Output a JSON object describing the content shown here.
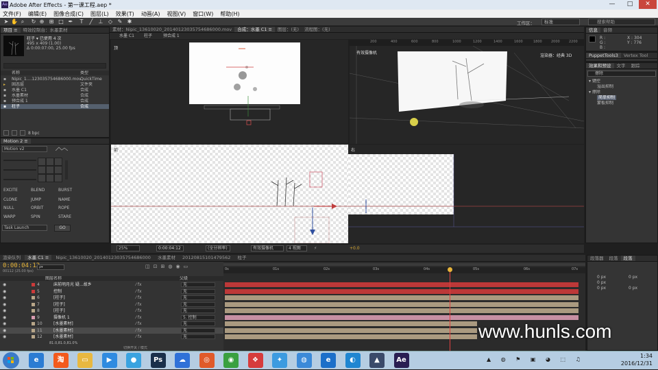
{
  "window": {
    "title": "Adobe After Effects - 第一课工程.aep *",
    "logo_text": "Ae",
    "minimize": "—",
    "maximize": "□",
    "close": "✕"
  },
  "menu": [
    "文件(F)",
    "编辑(E)",
    "图像合成(C)",
    "图层(L)",
    "效果(T)",
    "动画(A)",
    "视图(V)",
    "窗口(W)",
    "帮助(H)"
  ],
  "toolbar": {
    "workspace_label": "工作区：",
    "workspace_value": "标准",
    "search_placeholder": "搜索帮助"
  },
  "project": {
    "tabs": [
      "项目 ≡",
      "特效控制台：水墨素材"
    ],
    "item_name": "柱子 ▾ 已使用 4 次",
    "item_size": "495 x 409 (1.00)",
    "item_duration": "Δ 0:00:07:00, 25.00 fps",
    "columns": [
      "名称",
      "类型"
    ],
    "items": [
      {
        "name": "Nipic_1....123035754686000.mov",
        "type": "QuickTime"
      },
      {
        "name": "固态层",
        "type": "文件夹"
      },
      {
        "name": "水墨 C1",
        "type": "合成"
      },
      {
        "name": "水墨素材",
        "type": "合成"
      },
      {
        "name": "预合成 1",
        "type": "合成"
      },
      {
        "name": "柱子",
        "type": "合成"
      }
    ],
    "bpc": "8 bpc"
  },
  "motion": {
    "tab": "Motion 2 ≡",
    "preset": "Motion v2",
    "buttons": [
      "EXCITE",
      "BLEND",
      "BURST",
      "CLONE",
      "JUMP",
      "NAME",
      "NULL",
      "ORBIT",
      "ROPE",
      "WARP",
      "SPIN",
      "STARE"
    ],
    "task": "Task Launch",
    "go": "GO"
  },
  "viewer": {
    "tabs": [
      "素材：Nipic_13610020_20140123035754686000.mov",
      "合成：水墨 C1 ≡",
      "图层：(无)",
      "流程图：(无)"
    ],
    "subtabs": [
      "水墨 C1",
      "柱子",
      "预合成 1"
    ],
    "top_label": "顶",
    "camera_label": "有效摄像机",
    "front_label": "前",
    "right_label": "右",
    "renderer": "渲染器：经典 3D",
    "ruler": [
      "200",
      "400",
      "600",
      "800",
      "1000",
      "1200",
      "1400",
      "1600",
      "1800",
      "2000",
      "2200"
    ],
    "zoom": "25%",
    "timecode": "0:00:04:12",
    "resolution": "(全分辨率)",
    "view": "有效摄像机",
    "layout": "4 视图",
    "exposure": "+0.0"
  },
  "info": {
    "tabs": [
      "信息",
      "音频"
    ],
    "r": "R :",
    "g": "G :",
    "b": "B :",
    "a": "A : 0",
    "x": "X : 304",
    "y": "Y : 776"
  },
  "right_panels": {
    "tabs1": [
      "PuppetTools3",
      "Vertex Tool"
    ],
    "tabs2": [
      "效果和预设",
      "文字",
      "跟踪"
    ],
    "search": "擦除",
    "tree": [
      {
        "label": "▾ 键控",
        "indent": 0
      },
      {
        "label": "溢出抑制",
        "indent": 2
      },
      {
        "label": "▾ 擦除",
        "indent": 0
      },
      {
        "label": "简单抑制",
        "indent": 2
      },
      {
        "label": "蒙板抑制",
        "indent": 2
      }
    ]
  },
  "timeline": {
    "tabs": [
      "渲染队列",
      "水墨 C1 ≡",
      "Nipic_13610020_20140123035754686000",
      "水墨素材",
      "20120815101479562",
      "柱子"
    ],
    "timecode": "0:00:04:12",
    "frame": "00112 (25.00 fps)",
    "search_placeholder": "ρ▾",
    "header_source": "图层名称",
    "header_parent": "父级",
    "ruler": [
      "0s",
      "01s",
      "02s",
      "03s",
      "04s",
      "05s",
      "06s",
      "07s"
    ],
    "layers": [
      {
        "num": "4",
        "name": "床前明月光 疑...故乡",
        "parent": "无",
        "color": "#cc3a3a"
      },
      {
        "num": "5",
        "name": "控制",
        "parent": "无",
        "color": "#cc3a3a"
      },
      {
        "num": "6",
        "name": "[柱子]",
        "parent": "无",
        "color": "#b8a689"
      },
      {
        "num": "7",
        "name": "[柱子]",
        "parent": "无",
        "color": "#b8a689"
      },
      {
        "num": "8",
        "name": "[柱子]",
        "parent": "无",
        "color": "#b8a689"
      },
      {
        "num": "9",
        "name": "摄像机 1",
        "parent": "5. 控制",
        "color": "#d89ab0"
      },
      {
        "num": "10",
        "name": "[水墨素材]",
        "parent": "无",
        "color": "#b8a689"
      },
      {
        "num": "11",
        "name": "[水墨素材]",
        "parent": "无",
        "color": "#b8a689"
      },
      {
        "num": "12",
        "name": "[水墨素材]",
        "parent": "无",
        "color": "#b8a689"
      }
    ],
    "bottom_value": "81.0,81.0,81.0%",
    "switch_label": "切换开关 / 模式",
    "paragraph_tabs": [
      "段落器",
      "段落",
      "段落"
    ],
    "paragraph_values": [
      "0 px",
      "0 px",
      "0 px",
      "0 px",
      "0 px"
    ]
  },
  "watermark": "www.hunls.com",
  "taskbar": {
    "time": "1:34",
    "date": "2016/12/31",
    "apps": [
      {
        "icon": "ie-icon",
        "glyph": "e",
        "color": "#2b7cd3"
      },
      {
        "icon": "taobao-icon",
        "glyph": "淘",
        "color": "#f25a1c"
      },
      {
        "icon": "folder-icon",
        "glyph": "▭",
        "color": "#e8b840"
      },
      {
        "icon": "media-icon",
        "glyph": "▶",
        "color": "#2f8be0"
      },
      {
        "icon": "qq-icon",
        "glyph": "●",
        "color": "#39a3e0"
      },
      {
        "icon": "ps-icon",
        "glyph": "Ps",
        "color": "#1a2f4a"
      },
      {
        "icon": "baidu-icon",
        "glyph": "☁",
        "color": "#2f71d8"
      },
      {
        "icon": "chrome-alt-icon",
        "glyph": "◎",
        "color": "#e05a2a"
      },
      {
        "icon": "chrome-icon",
        "glyph": "◉",
        "color": "#3aa040"
      },
      {
        "icon": "app-icon",
        "glyph": "❖",
        "color": "#d63c3c"
      },
      {
        "icon": "bird-icon",
        "glyph": "✦",
        "color": "#3c9be0"
      },
      {
        "icon": "msg-icon",
        "glyph": "◍",
        "color": "#3c8ad8"
      },
      {
        "icon": "ie2-icon",
        "glyph": "e",
        "color": "#1b6fc9"
      },
      {
        "icon": "browser-icon",
        "glyph": "◐",
        "color": "#1f86d1"
      },
      {
        "icon": "encore-icon",
        "glyph": "▲",
        "color": "#3a4a6a"
      },
      {
        "icon": "ae-icon",
        "glyph": "Ae",
        "color": "#2a1e52"
      }
    ]
  }
}
